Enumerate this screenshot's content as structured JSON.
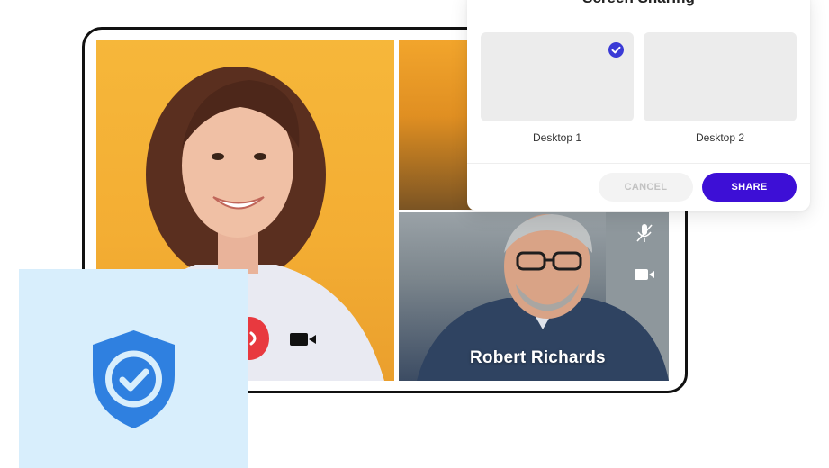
{
  "dialog": {
    "title": "Screen Sharing",
    "screens": [
      {
        "label": "Desktop 1",
        "selected": true
      },
      {
        "label": "Desktop 2",
        "selected": false
      }
    ],
    "cancel_label": "CANCEL",
    "share_label": "SHARE"
  },
  "call": {
    "participants": [
      {
        "name": ""
      },
      {
        "name": ""
      },
      {
        "name": "Robert Richards"
      }
    ]
  },
  "colors": {
    "accent": "#3d0fd6",
    "check": "#3b3bd6",
    "end_call": "#e8393f",
    "shield": "#2f80e0",
    "security_card_bg": "#d8eefc"
  },
  "icons": [
    "check-icon",
    "mic-muted-icon",
    "video-camera-icon",
    "end-call-icon",
    "shield-check-icon"
  ]
}
